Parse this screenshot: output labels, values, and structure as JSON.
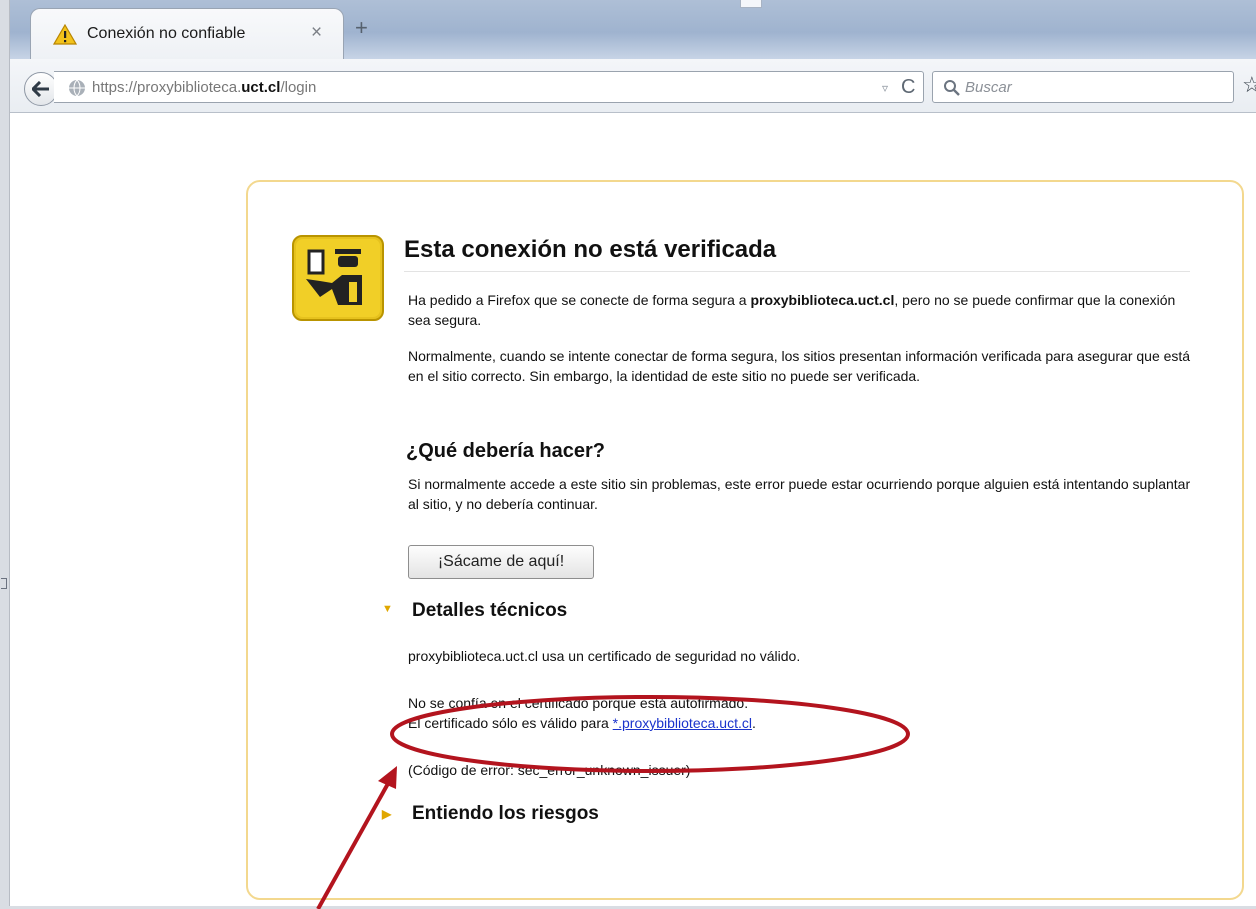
{
  "browser": {
    "tab": {
      "title": "Conexión no confiable",
      "close": "×"
    },
    "new_tab": "+",
    "url": {
      "prefix": "https://proxybiblioteca.",
      "domain": "uct.cl",
      "path": "/login"
    },
    "search": {
      "placeholder": "Buscar"
    },
    "reload": "C",
    "dropmarker": "▿",
    "bookmark": "☆"
  },
  "page": {
    "title": "Esta conexión no está verificada",
    "p1_before": "Ha pedido a Firefox que se conecte de forma segura a ",
    "p1_host": "proxybiblioteca.uct.cl",
    "p1_after": ", pero no se puede confirmar que la conexión sea segura.",
    "p2": "Normalmente, cuando se intente conectar de forma segura, los sitios presentan información verificada para asegurar que está en el sitio correcto. Sin embargo, la identidad de este sitio no puede ser verificada.",
    "what_heading": "¿Qué debería hacer?",
    "p3": "Si normalmente accede a este sitio sin problemas, este error puede estar ocurriendo porque alguien está intentando suplantar al sitio, y no debería continuar.",
    "get_me_out": "¡Sácame de aquí!",
    "technical": {
      "label": "Detalles técnicos",
      "line1": "proxybiblioteca.uct.cl usa un certificado de seguridad no válido.",
      "line2": "No se confía en el certificado porque está autofirmado.",
      "line3_before": "El certificado sólo es válido para ",
      "line3_link": "*.proxybiblioteca.uct.cl",
      "line3_after": ".",
      "error_code": "(Código de error: sec_error_unknown_issuer)"
    },
    "risks": {
      "label": "Entiendo los riesgos"
    }
  },
  "colors": {
    "annotation": "#b3141e",
    "accent": "#e0a700",
    "link": "#1a33cc"
  }
}
